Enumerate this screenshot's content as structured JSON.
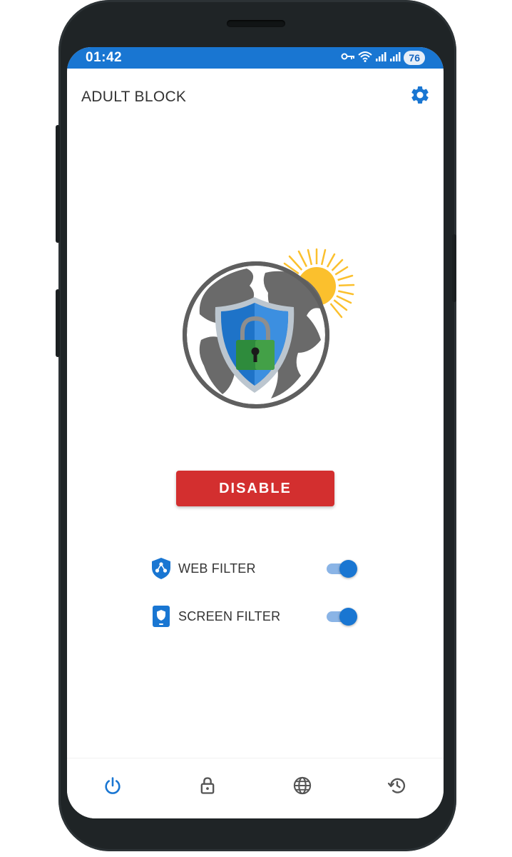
{
  "status_bar": {
    "time": "01:42",
    "battery": "76",
    "icons": [
      "vpn-key-icon",
      "wifi-icon",
      "signal-icon",
      "signal-icon"
    ]
  },
  "app_bar": {
    "title": "ADULT BLOCK",
    "settings_icon": "gear-icon"
  },
  "hero": {
    "icons": [
      "globe-icon",
      "shield-icon",
      "padlock-icon",
      "sun-icon"
    ]
  },
  "main": {
    "disable_label": "DISABLE"
  },
  "filters": [
    {
      "label": "WEB FILTER",
      "icon": "shield-share-icon",
      "enabled": true
    },
    {
      "label": "SCREEN FILTER",
      "icon": "phone-shield-icon",
      "enabled": true
    }
  ],
  "bottom_nav": {
    "items": [
      "power-icon",
      "lock-icon",
      "globe-icon",
      "history-icon"
    ],
    "active_index": 0
  },
  "colors": {
    "primary": "#1976d2",
    "danger": "#d32f2f",
    "sun": "#fbc02d",
    "globe": "#616161",
    "lock": "#388e3c"
  }
}
